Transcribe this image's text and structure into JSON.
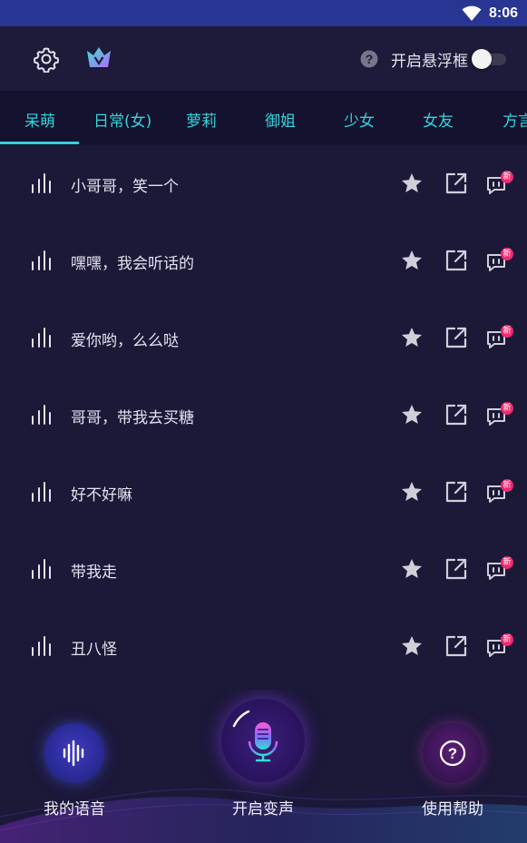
{
  "status_bar": {
    "time": "8:06"
  },
  "header": {
    "float_window_label": "开启悬浮框",
    "float_window_enabled": false
  },
  "tabs": [
    {
      "label": "呆萌",
      "active": true
    },
    {
      "label": "日常(女)",
      "active": false
    },
    {
      "label": "萝莉",
      "active": false
    },
    {
      "label": "御姐",
      "active": false
    },
    {
      "label": "少女",
      "active": false
    },
    {
      "label": "女友",
      "active": false
    },
    {
      "label": "方言",
      "active": false
    }
  ],
  "voice_items": [
    {
      "text": "小哥哥，笑一个",
      "badge": "新"
    },
    {
      "text": "嘿嘿，我会听话的",
      "badge": "新"
    },
    {
      "text": "爱你哟，么么哒",
      "badge": "新"
    },
    {
      "text": "哥哥，带我去买糖",
      "badge": "新"
    },
    {
      "text": "好不好嘛",
      "badge": "新"
    },
    {
      "text": "带我走",
      "badge": "新"
    },
    {
      "text": "丑八怪",
      "badge": "新"
    }
  ],
  "bottom_nav": {
    "my_voice_label": "我的语音",
    "start_voice_change_label": "开启变声",
    "help_label": "使用帮助"
  },
  "colors": {
    "accent": "#35d4dc",
    "background": "#1b1838",
    "status_bar": "#283593",
    "badge": "#ee2a6e"
  }
}
